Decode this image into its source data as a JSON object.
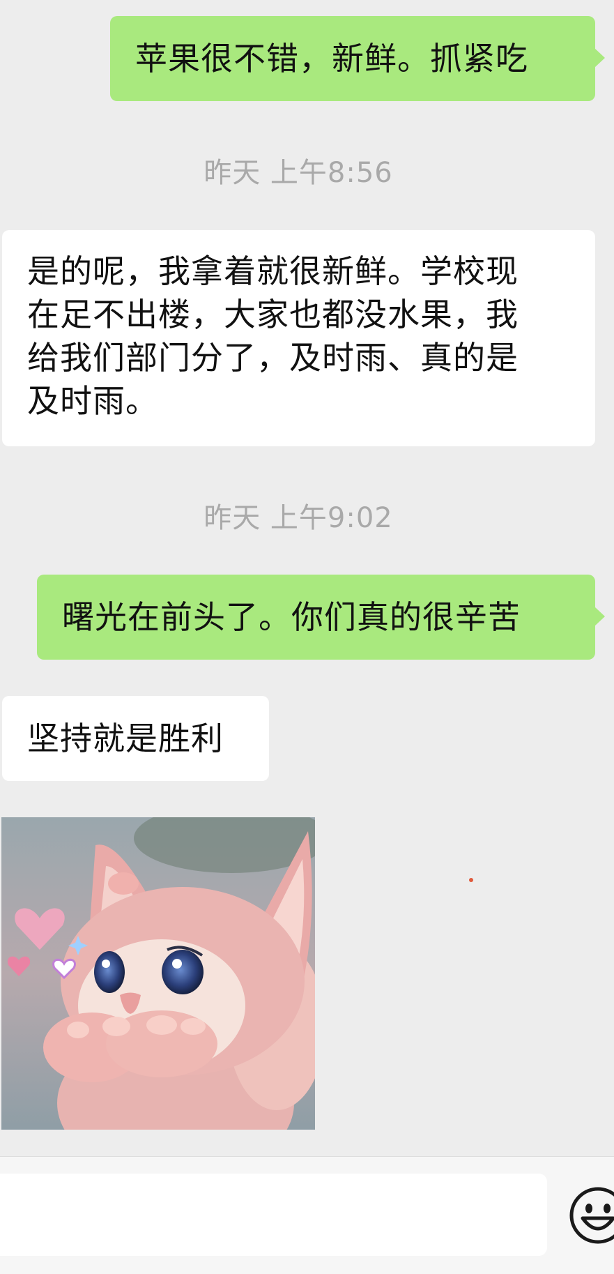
{
  "messages": [
    {
      "from": "me",
      "text": "苹果很不错，新鲜。抓紧吃"
    },
    {
      "timestamp": "昨天 上午8:56"
    },
    {
      "from": "them",
      "lines": [
        "是的呢，我拿着就很新鲜。学校现",
        "在足不出楼，大家也都没水果，我",
        "给我们部门分了，及时雨、真的是",
        "及时雨。"
      ]
    },
    {
      "timestamp": "昨天 上午9:02"
    },
    {
      "from": "me",
      "text": "曙光在前头了。你们真的很辛苦"
    },
    {
      "from": "them",
      "text": "坚持就是胜利"
    },
    {
      "from": "them",
      "sticker": "pink-fox-plush-blowing-kiss"
    }
  ],
  "input": {
    "value": "",
    "placeholder": ""
  },
  "icons": {
    "emoji": "smiley-face-icon"
  },
  "colors": {
    "background": "#ededed",
    "my_bubble": "#a9e97e",
    "their_bubble": "#ffffff",
    "timestamp": "#a9a9a9",
    "dot": "#e05a3c"
  }
}
